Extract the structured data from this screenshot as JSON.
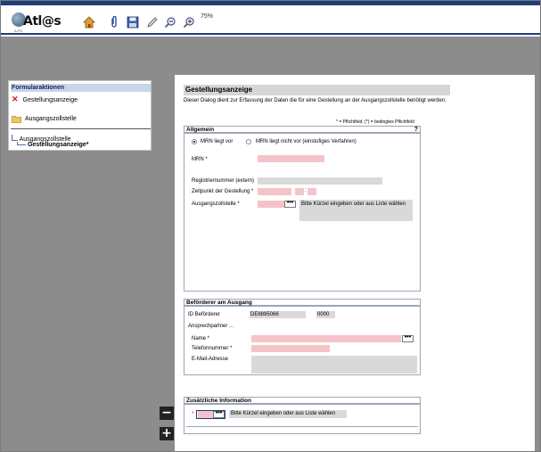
{
  "app": {
    "brand": "Atl@s",
    "brand_small": "A-PC",
    "zoom": "75%"
  },
  "toolbar": {
    "home": "home-icon",
    "attach": "paperclip-icon",
    "save": "floppy-disk-icon",
    "edit": "pencil-icon",
    "zoom_out": "zoom-out-icon",
    "zoom_in": "zoom-in-icon"
  },
  "sidebar": {
    "heading": "Formularaktionen",
    "items": [
      {
        "label": "Gestellungsanzeige",
        "icon": "close-icon"
      },
      {
        "label": "Ausgangszollstelle",
        "icon": "folder-icon"
      }
    ],
    "tree": {
      "parent": "Ausgangszollstelle",
      "child": "Gestellungsanzeige*"
    }
  },
  "form": {
    "title": "Gestellungsanzeige",
    "description": "Dieser Dialog dient zur Erfassung der Daten die für eine Gestellung an der Ausgangszollstelle benötigt werden.",
    "legend": "* = Pflichtfeld; (*) = bedingtes Pflichtfeld",
    "allgemein": {
      "title": "Allgemein",
      "help": "?",
      "radio_mrn": "MRN liegt vor",
      "radio_no_mrn": "MRN liegt nicht vor (einstufiges Verfahren)",
      "mrn_label": "MRN *",
      "registriernummer_label": "Registriernummer (extern)",
      "zeitpunkt_label": "Zeitpunkt der Gestellung *",
      "time_sep": ":",
      "ausgangszollstelle_label": "Ausgangszollstelle *",
      "ausgangszollstelle_hint": "Bitte Kürzel eingeben oder aus Liste wählen",
      "ellipsis": "•••"
    },
    "befoerderer": {
      "title": "Beförderer am Ausgang",
      "id_label": "ID Beförderer",
      "id_value": "DE8895066",
      "id_suffix": "0000",
      "ansprechpartner_label": "Ansprechpartner ...",
      "name_label": "Name *",
      "telefon_label": "Telefonnummer *",
      "email_label": "E-Mail-Adresse",
      "ellipsis": "•••"
    },
    "zusatz": {
      "title": "Zusätzliche Information",
      "required_star": "*",
      "hint": "Bitte Kürzel eingeben oder aus Liste wählen",
      "ellipsis": "•••"
    }
  },
  "zoom_controls": {
    "minus": "−",
    "plus": "+"
  }
}
